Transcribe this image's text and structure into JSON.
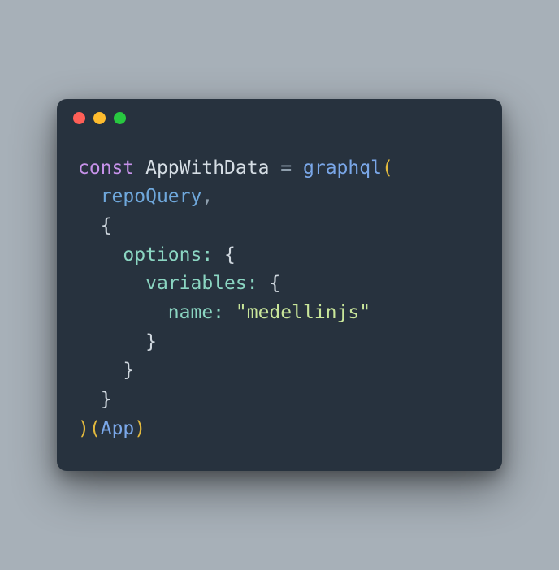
{
  "traffic_lights": {
    "close_color": "#ff5f57",
    "minimize_color": "#febc2e",
    "zoom_color": "#28c840"
  },
  "code": {
    "l1": {
      "kw": "const",
      "sp1": " ",
      "ident": "AppWithData",
      "sp2": " ",
      "op": "=",
      "sp3": " ",
      "fn": "graphql",
      "paren_open": "("
    },
    "l2": {
      "indent": "  ",
      "arg": "repoQuery",
      "comma": ","
    },
    "l3": {
      "indent": "  ",
      "brace_open": "{"
    },
    "l4": {
      "indent": "    ",
      "prop": "options",
      "colon": ":",
      "sp": " ",
      "brace_open": "{"
    },
    "l5": {
      "indent": "      ",
      "prop": "variables",
      "colon": ":",
      "sp": " ",
      "brace_open": "{"
    },
    "l6": {
      "indent": "        ",
      "prop": "name",
      "colon": ":",
      "sp": " ",
      "str": "\"medellinjs\""
    },
    "l7": {
      "indent": "      ",
      "brace_close": "}"
    },
    "l8": {
      "indent": "    ",
      "brace_close": "}"
    },
    "l9": {
      "indent": "  ",
      "brace_close": "}"
    },
    "l10": {
      "paren_close1": ")",
      "paren_open2": "(",
      "fn": "App",
      "paren_close2": ")"
    }
  }
}
